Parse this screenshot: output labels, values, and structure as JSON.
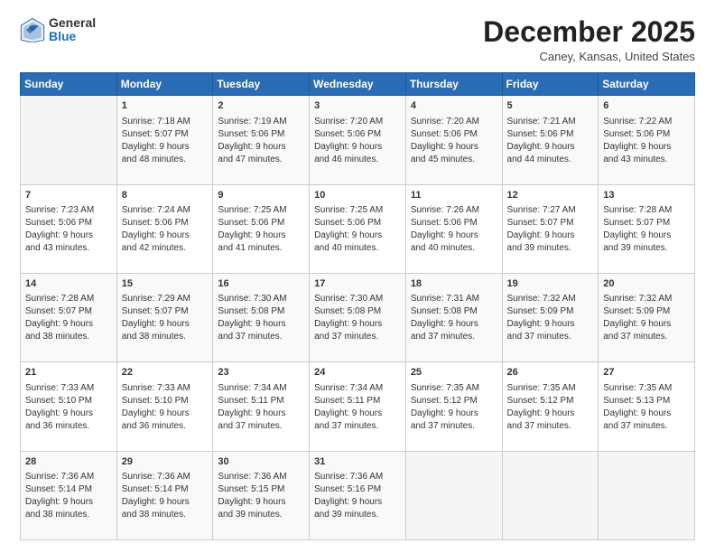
{
  "header": {
    "logo_general": "General",
    "logo_blue": "Blue",
    "month": "December 2025",
    "location": "Caney, Kansas, United States"
  },
  "weekdays": [
    "Sunday",
    "Monday",
    "Tuesday",
    "Wednesday",
    "Thursday",
    "Friday",
    "Saturday"
  ],
  "weeks": [
    [
      {
        "day": "",
        "info": ""
      },
      {
        "day": "1",
        "info": "Sunrise: 7:18 AM\nSunset: 5:07 PM\nDaylight: 9 hours\nand 48 minutes."
      },
      {
        "day": "2",
        "info": "Sunrise: 7:19 AM\nSunset: 5:06 PM\nDaylight: 9 hours\nand 47 minutes."
      },
      {
        "day": "3",
        "info": "Sunrise: 7:20 AM\nSunset: 5:06 PM\nDaylight: 9 hours\nand 46 minutes."
      },
      {
        "day": "4",
        "info": "Sunrise: 7:20 AM\nSunset: 5:06 PM\nDaylight: 9 hours\nand 45 minutes."
      },
      {
        "day": "5",
        "info": "Sunrise: 7:21 AM\nSunset: 5:06 PM\nDaylight: 9 hours\nand 44 minutes."
      },
      {
        "day": "6",
        "info": "Sunrise: 7:22 AM\nSunset: 5:06 PM\nDaylight: 9 hours\nand 43 minutes."
      }
    ],
    [
      {
        "day": "7",
        "info": "Sunrise: 7:23 AM\nSunset: 5:06 PM\nDaylight: 9 hours\nand 43 minutes."
      },
      {
        "day": "8",
        "info": "Sunrise: 7:24 AM\nSunset: 5:06 PM\nDaylight: 9 hours\nand 42 minutes."
      },
      {
        "day": "9",
        "info": "Sunrise: 7:25 AM\nSunset: 5:06 PM\nDaylight: 9 hours\nand 41 minutes."
      },
      {
        "day": "10",
        "info": "Sunrise: 7:25 AM\nSunset: 5:06 PM\nDaylight: 9 hours\nand 40 minutes."
      },
      {
        "day": "11",
        "info": "Sunrise: 7:26 AM\nSunset: 5:06 PM\nDaylight: 9 hours\nand 40 minutes."
      },
      {
        "day": "12",
        "info": "Sunrise: 7:27 AM\nSunset: 5:07 PM\nDaylight: 9 hours\nand 39 minutes."
      },
      {
        "day": "13",
        "info": "Sunrise: 7:28 AM\nSunset: 5:07 PM\nDaylight: 9 hours\nand 39 minutes."
      }
    ],
    [
      {
        "day": "14",
        "info": "Sunrise: 7:28 AM\nSunset: 5:07 PM\nDaylight: 9 hours\nand 38 minutes."
      },
      {
        "day": "15",
        "info": "Sunrise: 7:29 AM\nSunset: 5:07 PM\nDaylight: 9 hours\nand 38 minutes."
      },
      {
        "day": "16",
        "info": "Sunrise: 7:30 AM\nSunset: 5:08 PM\nDaylight: 9 hours\nand 37 minutes."
      },
      {
        "day": "17",
        "info": "Sunrise: 7:30 AM\nSunset: 5:08 PM\nDaylight: 9 hours\nand 37 minutes."
      },
      {
        "day": "18",
        "info": "Sunrise: 7:31 AM\nSunset: 5:08 PM\nDaylight: 9 hours\nand 37 minutes."
      },
      {
        "day": "19",
        "info": "Sunrise: 7:32 AM\nSunset: 5:09 PM\nDaylight: 9 hours\nand 37 minutes."
      },
      {
        "day": "20",
        "info": "Sunrise: 7:32 AM\nSunset: 5:09 PM\nDaylight: 9 hours\nand 37 minutes."
      }
    ],
    [
      {
        "day": "21",
        "info": "Sunrise: 7:33 AM\nSunset: 5:10 PM\nDaylight: 9 hours\nand 36 minutes."
      },
      {
        "day": "22",
        "info": "Sunrise: 7:33 AM\nSunset: 5:10 PM\nDaylight: 9 hours\nand 36 minutes."
      },
      {
        "day": "23",
        "info": "Sunrise: 7:34 AM\nSunset: 5:11 PM\nDaylight: 9 hours\nand 37 minutes."
      },
      {
        "day": "24",
        "info": "Sunrise: 7:34 AM\nSunset: 5:11 PM\nDaylight: 9 hours\nand 37 minutes."
      },
      {
        "day": "25",
        "info": "Sunrise: 7:35 AM\nSunset: 5:12 PM\nDaylight: 9 hours\nand 37 minutes."
      },
      {
        "day": "26",
        "info": "Sunrise: 7:35 AM\nSunset: 5:12 PM\nDaylight: 9 hours\nand 37 minutes."
      },
      {
        "day": "27",
        "info": "Sunrise: 7:35 AM\nSunset: 5:13 PM\nDaylight: 9 hours\nand 37 minutes."
      }
    ],
    [
      {
        "day": "28",
        "info": "Sunrise: 7:36 AM\nSunset: 5:14 PM\nDaylight: 9 hours\nand 38 minutes."
      },
      {
        "day": "29",
        "info": "Sunrise: 7:36 AM\nSunset: 5:14 PM\nDaylight: 9 hours\nand 38 minutes."
      },
      {
        "day": "30",
        "info": "Sunrise: 7:36 AM\nSunset: 5:15 PM\nDaylight: 9 hours\nand 39 minutes."
      },
      {
        "day": "31",
        "info": "Sunrise: 7:36 AM\nSunset: 5:16 PM\nDaylight: 9 hours\nand 39 minutes."
      },
      {
        "day": "",
        "info": ""
      },
      {
        "day": "",
        "info": ""
      },
      {
        "day": "",
        "info": ""
      }
    ]
  ]
}
